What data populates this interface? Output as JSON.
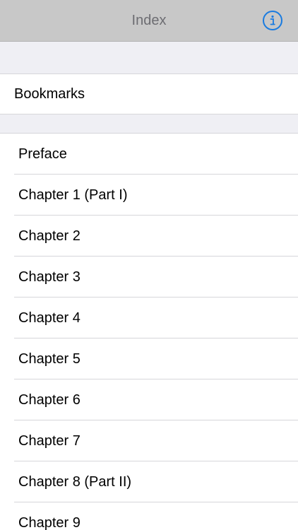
{
  "navbar": {
    "title": "Index",
    "info_icon": "info-icon",
    "accent_color": "#1a7be0"
  },
  "bookmarks": {
    "label": "Bookmarks"
  },
  "chapters": [
    {
      "label": "Preface"
    },
    {
      "label": "Chapter 1 (Part I)"
    },
    {
      "label": "Chapter 2"
    },
    {
      "label": "Chapter 3"
    },
    {
      "label": "Chapter 4"
    },
    {
      "label": "Chapter 5"
    },
    {
      "label": "Chapter 6"
    },
    {
      "label": "Chapter 7"
    },
    {
      "label": "Chapter 8 (Part II)"
    },
    {
      "label": "Chapter 9"
    }
  ]
}
